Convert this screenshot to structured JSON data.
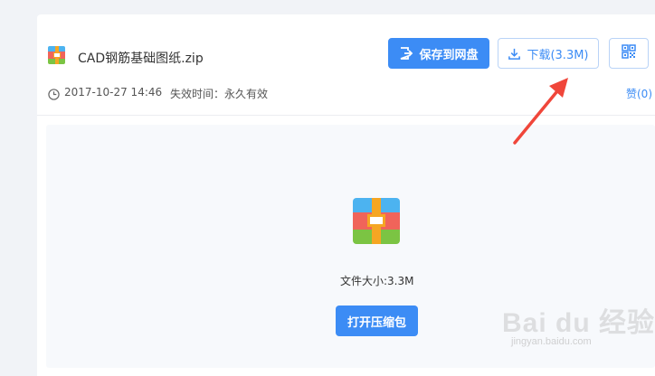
{
  "file": {
    "name": "CAD钢筋基础图纸.zip",
    "date": "2017-10-27 14:46",
    "expiry_label": "失效时间：",
    "expiry_value": "永久有效"
  },
  "toolbar": {
    "save_label": "保存到网盘",
    "download_label": "下载(3.3M)",
    "like_label": "赞(0)"
  },
  "preview": {
    "size_label": "文件大小:3.3M",
    "open_label": "打开压缩包"
  },
  "watermark": {
    "logo": "Bai du 经验",
    "url": "jingyan.baidu.com"
  },
  "colors": {
    "accent": "#3c8cf5",
    "arrow": "#f0463a",
    "zip_blue": "#4cb3f0",
    "zip_red": "#f0645a",
    "zip_green": "#7bc443",
    "zip_orange": "#f5a623"
  }
}
